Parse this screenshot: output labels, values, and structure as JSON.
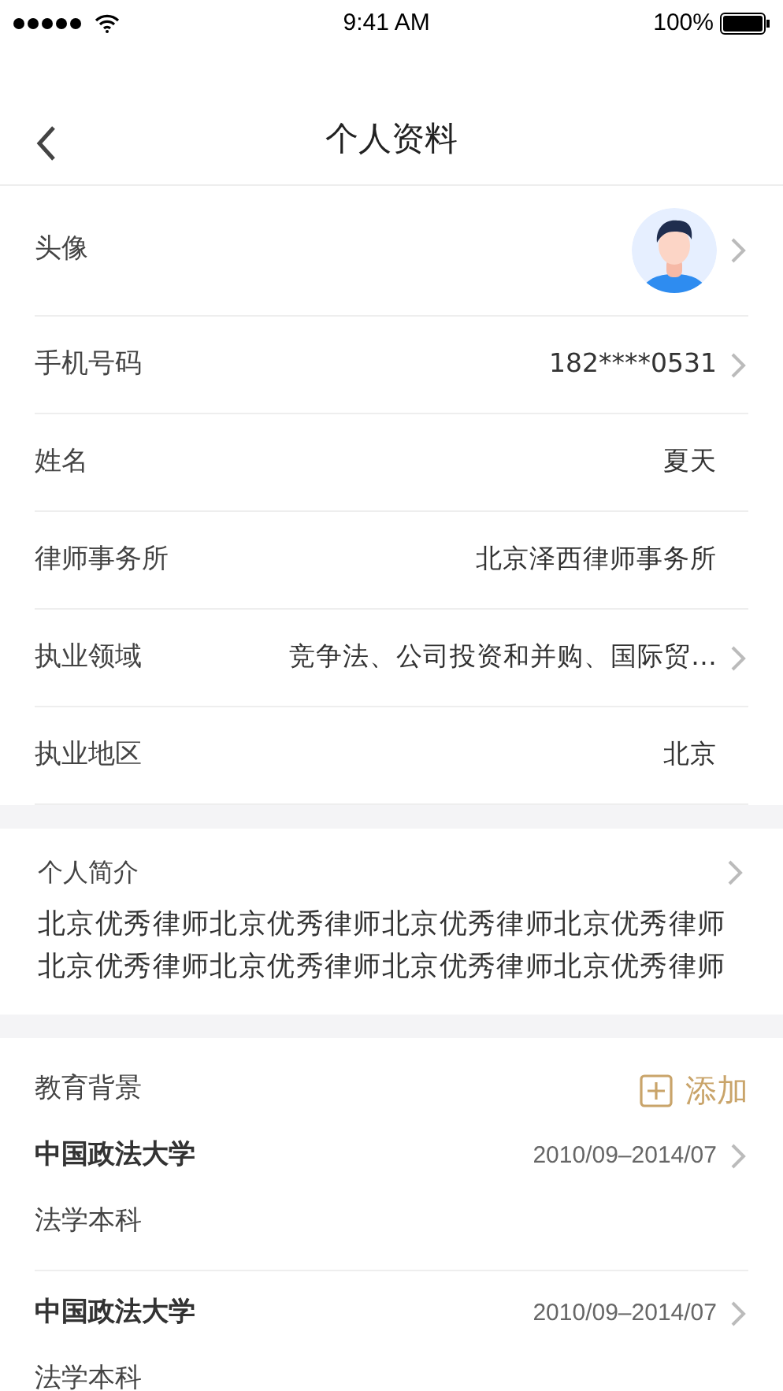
{
  "status_bar": {
    "time": "9:41 AM",
    "battery": "100%"
  },
  "nav": {
    "title": "个人资料"
  },
  "profile_rows": [
    {
      "kind": "avatar",
      "label": "头像",
      "chevron": true
    },
    {
      "kind": "text",
      "label": "手机号码",
      "value": "182****0531",
      "chevron": true
    },
    {
      "kind": "text",
      "label": "姓名",
      "value": "夏天",
      "chevron": false
    },
    {
      "kind": "text",
      "label": "律师事务所",
      "value": "北京泽西律师事务所",
      "chevron": false
    },
    {
      "kind": "text",
      "label": "执业领域",
      "value": "竞争法、公司投资和并购、国际贸…",
      "chevron": true
    },
    {
      "kind": "text",
      "label": "执业地区",
      "value": "北京",
      "chevron": false
    }
  ],
  "intro": {
    "label": "个人简介",
    "text": "北京优秀律师北京优秀律师北京优秀律师北京优秀律师北京优秀律师北京优秀律师北京优秀律师北京优秀律师"
  },
  "education": {
    "label": "教育背景",
    "add_button": "添加",
    "items": [
      {
        "school": "中国政法大学",
        "period": "2010/09–2014/07",
        "degree": "法学本科"
      },
      {
        "school": "中国政法大学",
        "period": "2010/09–2014/07",
        "degree": "法学本科"
      }
    ]
  }
}
